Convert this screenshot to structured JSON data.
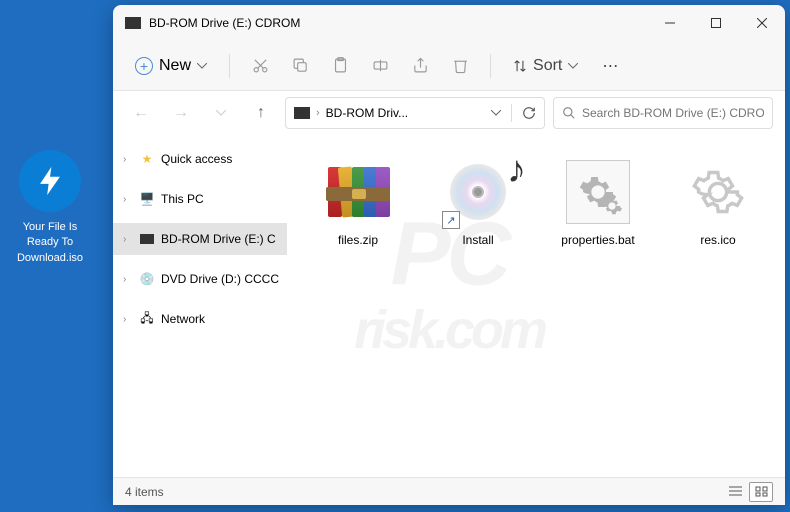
{
  "desktop": {
    "file_label": "Your File Is Ready To Download.iso"
  },
  "window": {
    "title": "BD-ROM Drive (E:) CDROM"
  },
  "toolbar": {
    "new_label": "New",
    "sort_label": "Sort"
  },
  "address": {
    "path": "BD-ROM Driv..."
  },
  "search": {
    "placeholder": "Search BD-ROM Drive (E:) CDROM"
  },
  "sidebar": {
    "items": [
      {
        "label": "Quick access",
        "icon": "star"
      },
      {
        "label": "This PC",
        "icon": "pc"
      },
      {
        "label": "BD-ROM Drive (E:) C",
        "icon": "disc",
        "selected": true
      },
      {
        "label": "DVD Drive (D:) CCCC",
        "icon": "dvd"
      },
      {
        "label": "Network",
        "icon": "net"
      }
    ]
  },
  "files": [
    {
      "name": "files.zip",
      "type": "zip"
    },
    {
      "name": "Install",
      "type": "disc-shortcut"
    },
    {
      "name": "properties.bat",
      "type": "bat"
    },
    {
      "name": "res.ico",
      "type": "ico"
    }
  ],
  "status": {
    "count_label": "4 items"
  }
}
